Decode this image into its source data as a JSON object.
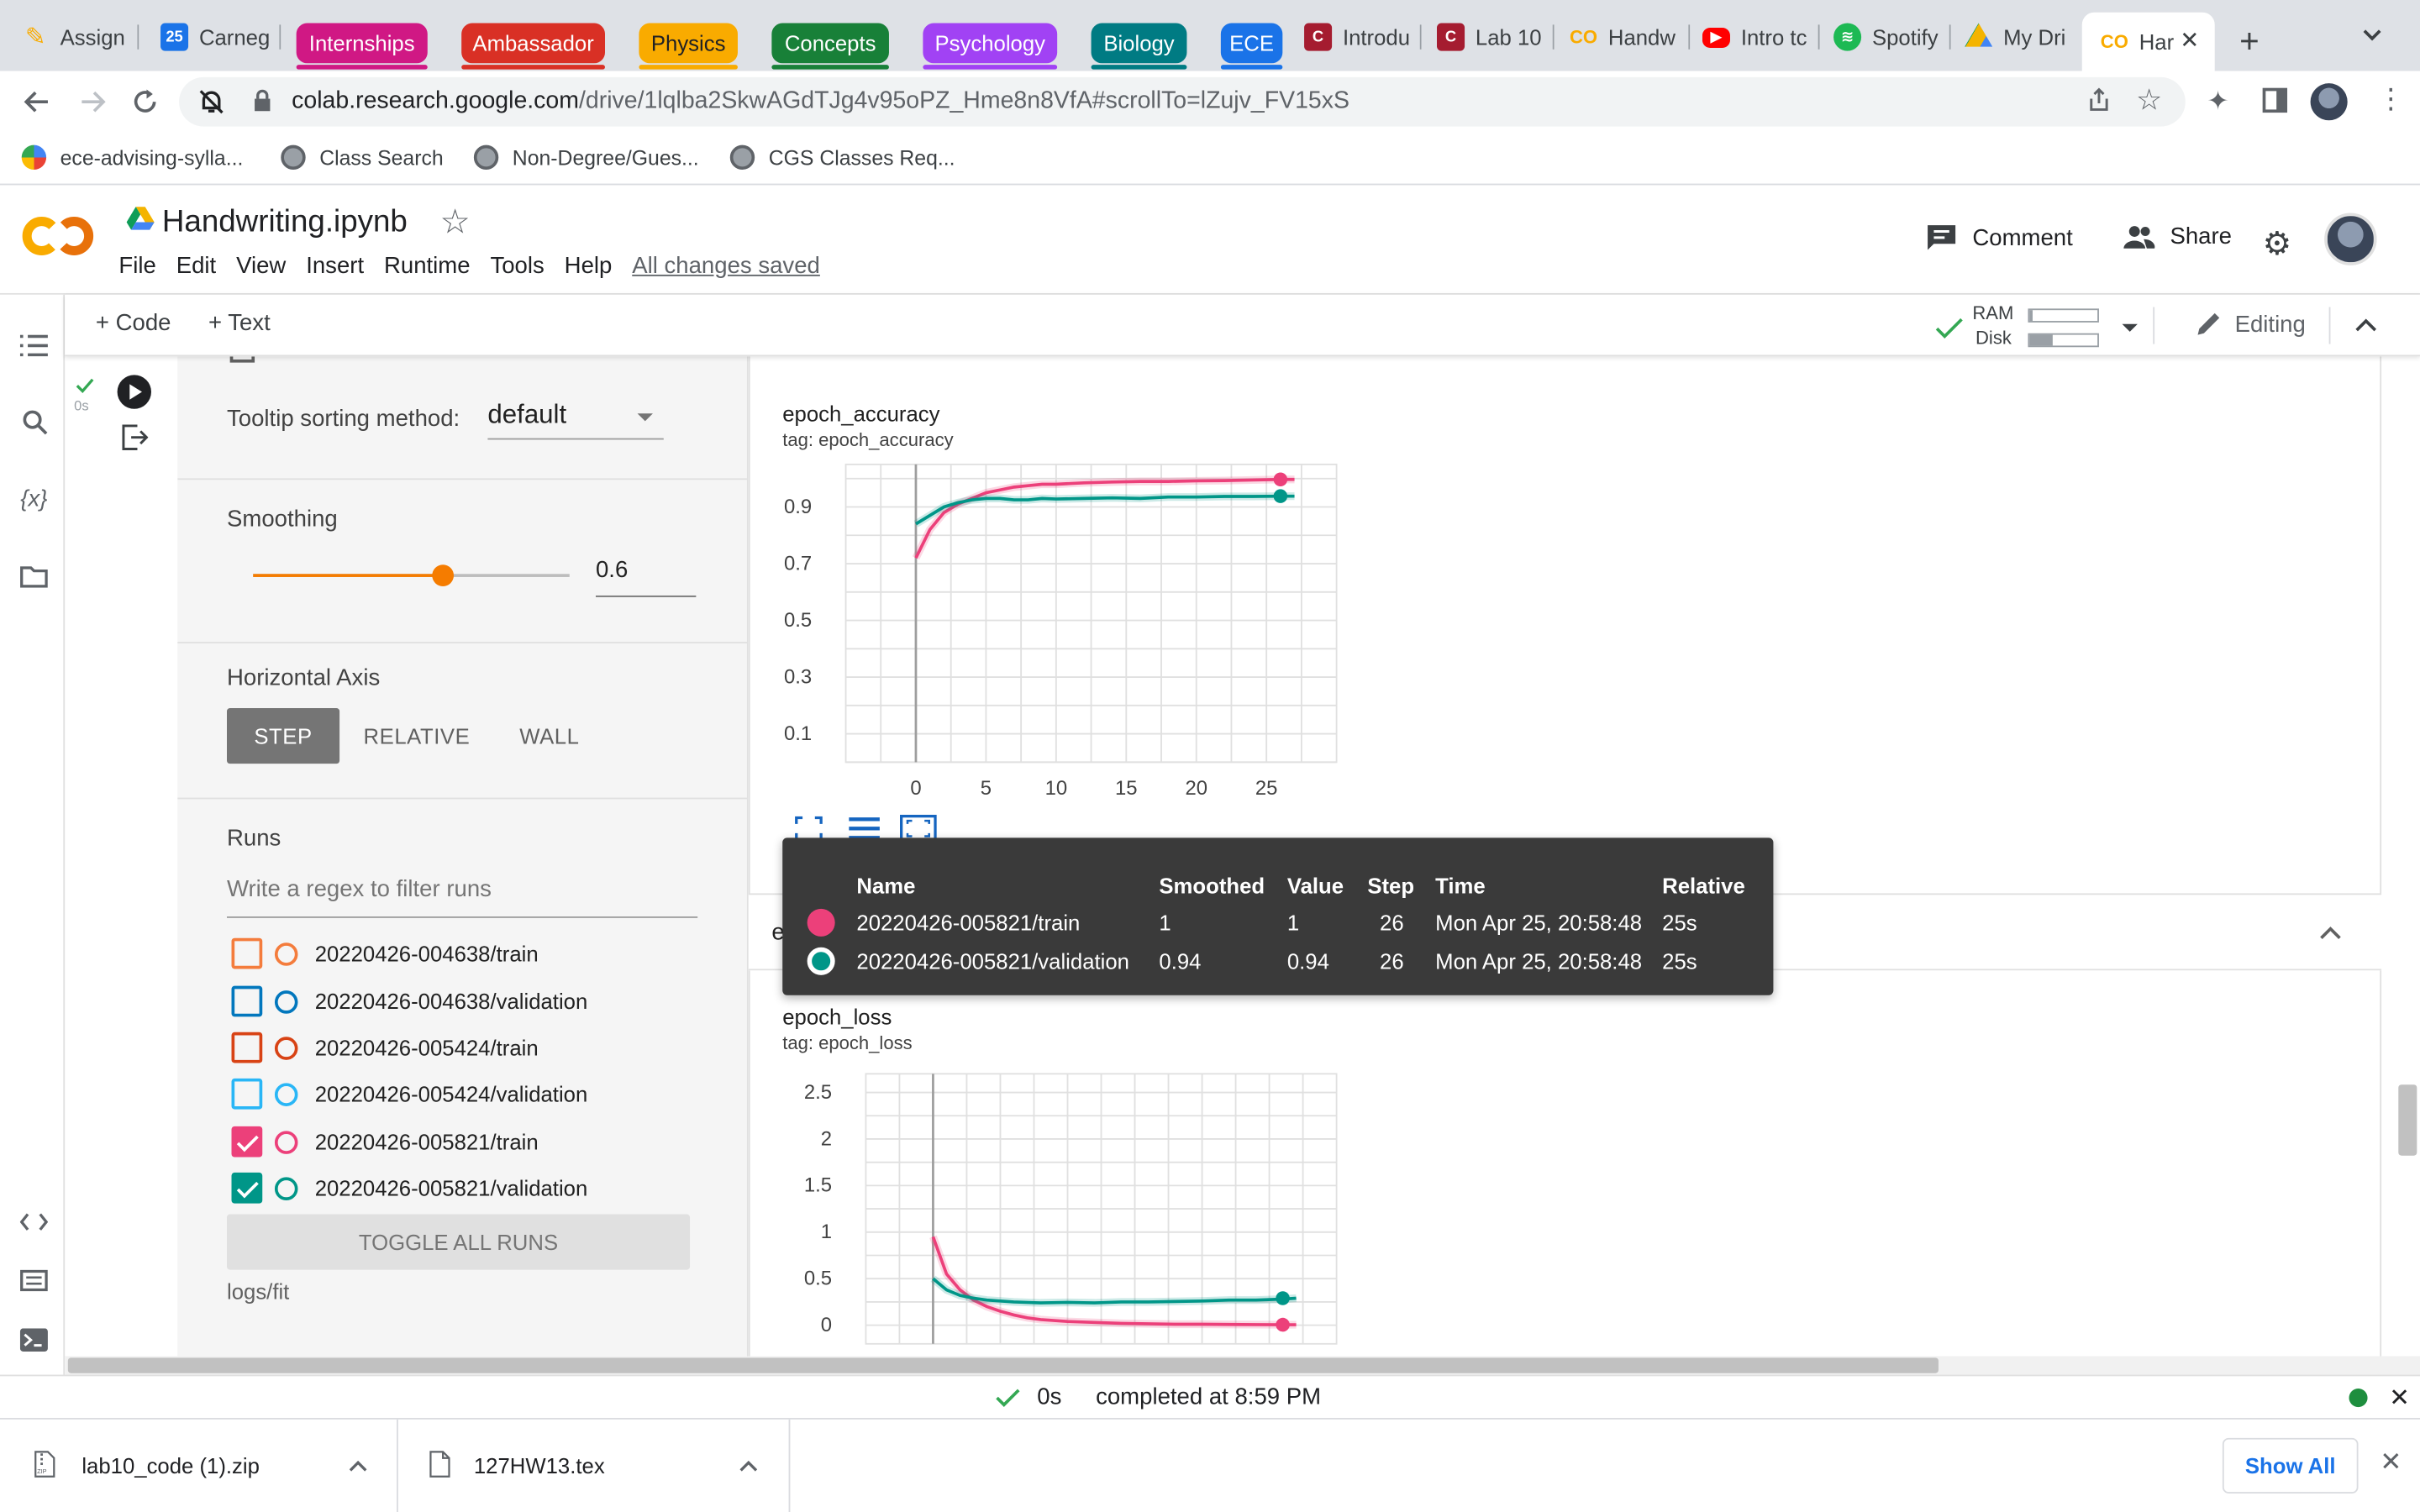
{
  "browser": {
    "tabs": [
      {
        "label": "Assign",
        "icon": "pencil-icon",
        "color": "#f9ab00"
      },
      {
        "label": "Carneg",
        "icon": "calendar-icon",
        "color": "#1a73e8"
      }
    ],
    "groups": [
      {
        "label": "Internships",
        "color": "#d01884"
      },
      {
        "label": "Ambassador",
        "color": "#d93025"
      },
      {
        "label": "Physics",
        "color": "#f9ab00"
      },
      {
        "label": "Concepts",
        "color": "#188038"
      },
      {
        "label": "Psychology",
        "color": "#a142f4"
      },
      {
        "label": "Biology",
        "color": "#007b83"
      },
      {
        "label": "ECE",
        "color": "#1a73e8"
      }
    ],
    "tabs2": [
      {
        "label": "Introdu",
        "icon": "canvas-icon",
        "color": "#a51c30"
      },
      {
        "label": "Lab 10",
        "icon": "canvas-icon",
        "color": "#a51c30"
      },
      {
        "label": "Handw",
        "icon": "colab-icon",
        "color": "#f9ab00"
      },
      {
        "label": "Intro tc",
        "icon": "youtube-icon",
        "color": "#ff0000"
      },
      {
        "label": "Spotify",
        "icon": "spotify-icon",
        "color": "#1db954"
      },
      {
        "label": "My Dri",
        "icon": "drive-icon",
        "color": "#0f9d58"
      }
    ],
    "active_tab": {
      "label": "Har",
      "icon": "colab-icon"
    },
    "url_host": "colab.research.google.com",
    "url_path": "/drive/1lqlba2SkwAGdTJg4v95oPZ_Hme8n8VfA#scrollTo=lZujv_FV15xS",
    "bookmarks": [
      {
        "label": "ece-advising-sylla..."
      },
      {
        "label": "Class Search"
      },
      {
        "label": "Non-Degree/Gues..."
      },
      {
        "label": "CGS Classes Req..."
      }
    ]
  },
  "colab": {
    "notebook_title": "Handwriting.ipynb",
    "menu": [
      "File",
      "Edit",
      "View",
      "Insert",
      "Runtime",
      "Tools",
      "Help"
    ],
    "saved_status": "All changes saved",
    "comment_label": "Comment",
    "share_label": "Share",
    "add_code": "Code",
    "add_text": "Text",
    "ram_label": "RAM",
    "disk_label": "Disk",
    "ram_usage": 0.05,
    "disk_usage": 0.35,
    "editing_label": "Editing",
    "cell_exec_time": "0s"
  },
  "tensorboard": {
    "tooltip_sorting_label": "Tooltip sorting method:",
    "tooltip_sorting_value": "default",
    "smoothing_label": "Smoothing",
    "smoothing_value": "0.6",
    "smoothing_fraction": 0.6,
    "horizontal_axis_label": "Horizontal Axis",
    "axis_options": [
      "STEP",
      "RELATIVE",
      "WALL"
    ],
    "axis_selected": "STEP",
    "runs_label": "Runs",
    "runs_filter_placeholder": "Write a regex to filter runs",
    "runs": [
      {
        "name": "20220426-004638/train",
        "color": "#f47c3c",
        "checked": false
      },
      {
        "name": "20220426-004638/validation",
        "color": "#0277bd",
        "checked": false
      },
      {
        "name": "20220426-005424/train",
        "color": "#d84315",
        "checked": false
      },
      {
        "name": "20220426-005424/validation",
        "color": "#29b6f6",
        "checked": false
      },
      {
        "name": "20220426-005821/train",
        "color": "#ec407a",
        "checked": true
      },
      {
        "name": "20220426-005821/validation",
        "color": "#009688",
        "checked": true
      }
    ],
    "toggle_all_label": "TOGGLE ALL RUNS",
    "log_dir": "logs/fit",
    "group_header_label": "epoch_loss",
    "tooltip": {
      "headers": [
        "Name",
        "Smoothed",
        "Value",
        "Step",
        "Time",
        "Relative"
      ],
      "rows": [
        {
          "color": "#ec407a",
          "name": "20220426-005821/train",
          "smoothed": "1",
          "value": "1",
          "step": "26",
          "time": "Mon Apr 25, 20:58:48",
          "relative": "25s"
        },
        {
          "color": "#009688",
          "name": "20220426-005821/validation",
          "smoothed": "0.94",
          "value": "0.94",
          "step": "26",
          "time": "Mon Apr 25, 20:58:48",
          "relative": "25s"
        }
      ]
    }
  },
  "chart_data": [
    {
      "type": "line",
      "title": "epoch_accuracy",
      "subtitle": "tag: epoch_accuracy",
      "xlim": [
        -5,
        30
      ],
      "ylim": [
        0,
        1.05
      ],
      "xticks": [
        0,
        5,
        10,
        15,
        20,
        25
      ],
      "yticks": [
        0.1,
        0.3,
        0.5,
        0.7,
        0.9
      ],
      "grid": true,
      "series": [
        {
          "name": "20220426-005821/train",
          "color": "#ec407a",
          "x": [
            0,
            1,
            2,
            3,
            4,
            5,
            6,
            7,
            8,
            9,
            10,
            12,
            14,
            16,
            18,
            20,
            22,
            24,
            26,
            27
          ],
          "y": [
            0.72,
            0.82,
            0.88,
            0.91,
            0.93,
            0.95,
            0.96,
            0.97,
            0.975,
            0.98,
            0.98,
            0.985,
            0.988,
            0.99,
            0.99,
            0.992,
            0.993,
            0.995,
            0.997,
            0.997
          ]
        },
        {
          "name": "20220426-005821/validation",
          "color": "#009688",
          "x": [
            0,
            1,
            2,
            3,
            4,
            5,
            6,
            7,
            8,
            9,
            10,
            12,
            14,
            16,
            18,
            20,
            22,
            24,
            26,
            27
          ],
          "y": [
            0.84,
            0.87,
            0.9,
            0.915,
            0.925,
            0.93,
            0.93,
            0.925,
            0.925,
            0.93,
            0.928,
            0.93,
            0.932,
            0.93,
            0.935,
            0.935,
            0.937,
            0.937,
            0.938,
            0.938
          ]
        }
      ],
      "markers": [
        {
          "series": 0,
          "x": 26,
          "y": 0.997
        },
        {
          "series": 1,
          "x": 26,
          "y": 0.938
        }
      ]
    },
    {
      "type": "line",
      "title": "epoch_loss",
      "subtitle": "tag: epoch_loss",
      "xlim": [
        -5,
        30
      ],
      "ylim": [
        -0.2,
        2.7
      ],
      "xticks": [],
      "yticks": [
        0,
        0.5,
        1,
        1.5,
        2,
        2.5
      ],
      "grid": true,
      "series": [
        {
          "name": "20220426-005821/train",
          "color": "#ec407a",
          "x": [
            0,
            1,
            2,
            3,
            4,
            5,
            6,
            7,
            8,
            10,
            12,
            14,
            16,
            18,
            20,
            22,
            24,
            26,
            27
          ],
          "y": [
            0.95,
            0.55,
            0.38,
            0.27,
            0.2,
            0.15,
            0.11,
            0.08,
            0.06,
            0.04,
            0.03,
            0.02,
            0.015,
            0.01,
            0.01,
            0.008,
            0.006,
            0.005,
            0.005
          ]
        },
        {
          "name": "20220426-005821/validation",
          "color": "#009688",
          "x": [
            0,
            1,
            2,
            3,
            4,
            5,
            6,
            8,
            10,
            12,
            14,
            16,
            18,
            20,
            22,
            24,
            26,
            27
          ],
          "y": [
            0.5,
            0.38,
            0.32,
            0.29,
            0.27,
            0.26,
            0.25,
            0.24,
            0.245,
            0.24,
            0.25,
            0.25,
            0.255,
            0.26,
            0.27,
            0.27,
            0.28,
            0.29
          ]
        }
      ],
      "markers": [
        {
          "series": 0,
          "x": 26,
          "y": 0.005
        },
        {
          "series": 1,
          "x": 26,
          "y": 0.29
        }
      ]
    }
  ],
  "status": {
    "exec_time": "0s",
    "completed_text": "completed at 8:59 PM"
  },
  "downloads": {
    "items": [
      {
        "name": "lab10_code (1).zip"
      },
      {
        "name": "127HW13.tex"
      }
    ],
    "show_all_label": "Show All"
  }
}
